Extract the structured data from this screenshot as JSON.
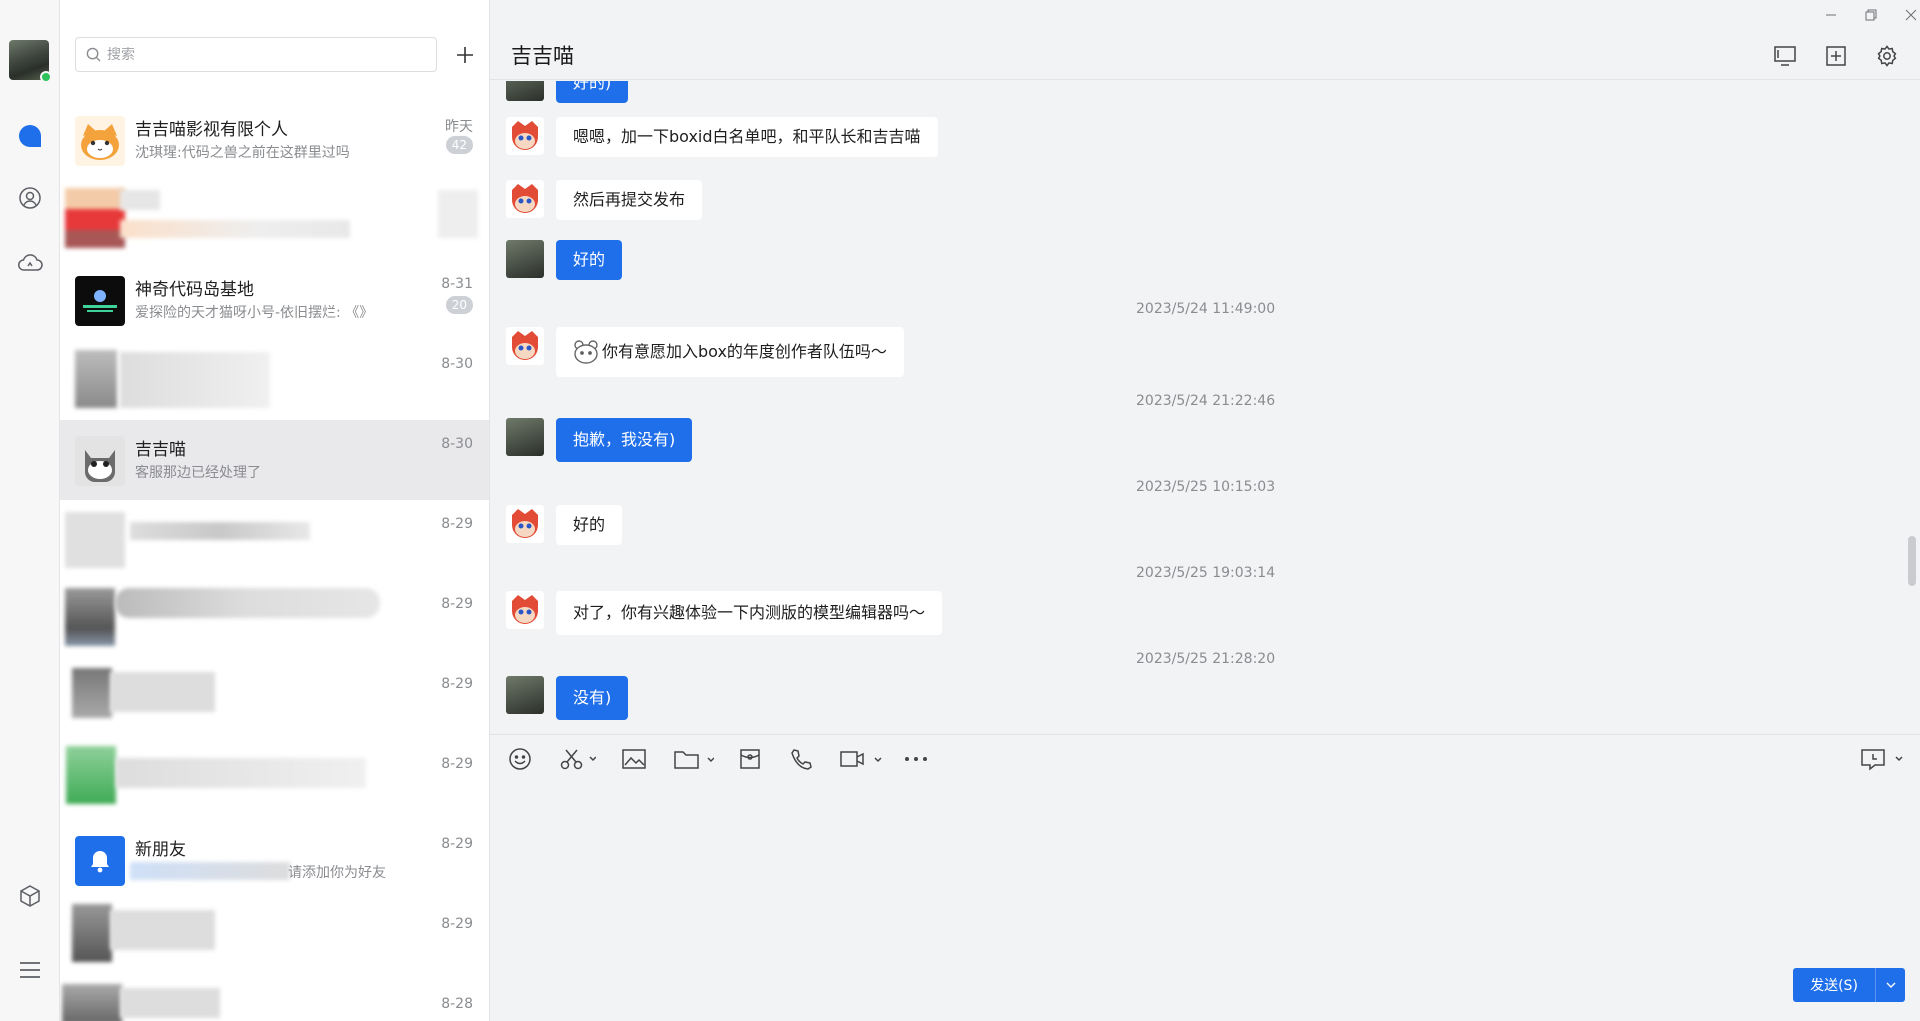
{
  "search": {
    "placeholder": "搜索"
  },
  "conversations": [
    {
      "name": "吉吉喵影视有限个人",
      "preview": "沈琪瑆:代码之兽之前在这群里过吗",
      "time": "昨天",
      "badge": "42"
    },
    {
      "name": "",
      "preview": "",
      "time": "",
      "badge": ""
    },
    {
      "name": "神奇代码岛基地",
      "preview": "爱探险的天才猫呀小号-依旧摆烂: 《》",
      "time": "8-31",
      "badge": "20"
    },
    {
      "name": "",
      "preview": "",
      "time": "8-30",
      "badge": ""
    },
    {
      "name": "吉吉喵",
      "preview": "客服那边已经处理了",
      "time": "8-30",
      "badge": ""
    },
    {
      "name": "",
      "preview": "",
      "time": "8-29",
      "badge": ""
    },
    {
      "name": "",
      "preview": "",
      "time": "8-29",
      "badge": ""
    },
    {
      "name": "",
      "preview": "",
      "time": "8-29",
      "badge": ""
    },
    {
      "name": "",
      "preview": "",
      "time": "8-29",
      "badge": ""
    },
    {
      "name": "新朋友",
      "preview": "请添加你为好友",
      "time": "8-29",
      "badge": ""
    },
    {
      "name": "",
      "preview": "",
      "time": "8-29",
      "badge": ""
    },
    {
      "name": "",
      "preview": "",
      "time": "8-28",
      "badge": ""
    }
  ],
  "chat": {
    "title": "吉吉喵",
    "messages": [
      {
        "from": "self",
        "text": "好的)"
      },
      {
        "from": "other",
        "text": "嗯嗯，加一下boxid白名单吧，和平队长和吉吉喵"
      },
      {
        "from": "other",
        "text": "然后再提交发布"
      },
      {
        "from": "self",
        "text": "好的"
      },
      {
        "timestamp": "2023/5/24 11:49:00"
      },
      {
        "from": "other",
        "text": "你有意愿加入box的年度创作者队伍吗～"
      },
      {
        "timestamp": "2023/5/24 21:22:46"
      },
      {
        "from": "self",
        "text": "抱歉，我没有)"
      },
      {
        "timestamp": "2023/5/25 10:15:03"
      },
      {
        "from": "other",
        "text": "好的"
      },
      {
        "timestamp": "2023/5/25 19:03:14"
      },
      {
        "from": "other",
        "text": "对了，你有兴趣体验一下内测版的模型编辑器吗～"
      },
      {
        "timestamp": "2023/5/25 21:28:20"
      },
      {
        "from": "self",
        "text": "没有)"
      }
    ]
  },
  "composer": {
    "send_label": "发送(S)"
  },
  "icons": {
    "rail": [
      "chat-icon",
      "contacts-icon",
      "cloud-icon",
      "box-icon",
      "menu-icon"
    ],
    "header": [
      "screen-share-icon",
      "add-member-icon",
      "settings-icon"
    ],
    "toolbar": [
      "emoji-icon",
      "scissors-icon",
      "image-icon",
      "folder-icon",
      "red-packet-icon",
      "phone-icon",
      "video-icon",
      "more-icon",
      "chat-history-icon"
    ]
  },
  "colors": {
    "accent": "#1f6feb",
    "online": "#2fc25b",
    "selected_row": "#e9e9ec"
  }
}
